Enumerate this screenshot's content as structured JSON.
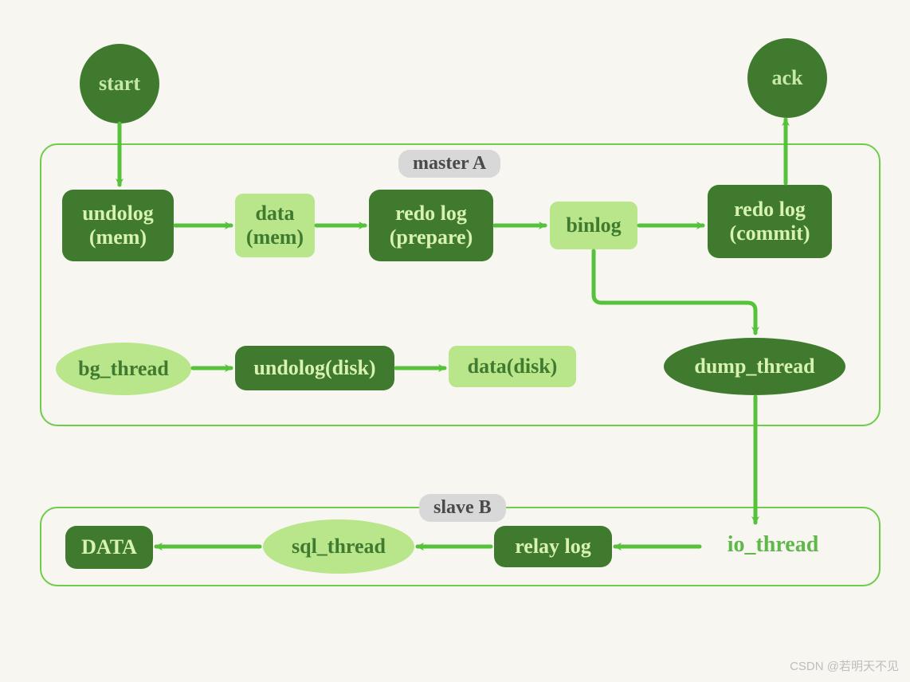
{
  "diagram": {
    "start": "start",
    "ack": "ack",
    "master_label": "master A",
    "slave_label": "slave B",
    "undolog_mem": "undolog\n(mem)",
    "data_mem": "data\n(mem)",
    "redolog_prepare": "redo log\n(prepare)",
    "binlog": "binlog",
    "redolog_commit": "redo log\n(commit)",
    "bg_thread": "bg_thread",
    "undolog_disk": "undolog(disk)",
    "data_disk": "data(disk)",
    "dump_thread": "dump_thread",
    "io_thread": "io_thread",
    "relay_log": "relay log",
    "sql_thread": "sql_thread",
    "data_final": "DATA",
    "watermark": "CSDN @若明天不见"
  },
  "colors": {
    "bg": "#f7f6f1",
    "dark_green": "#3f7a2e",
    "light_green": "#b9e58b",
    "bright_green": "#6fcc4a",
    "tag_bg": "#d8d8d8"
  }
}
